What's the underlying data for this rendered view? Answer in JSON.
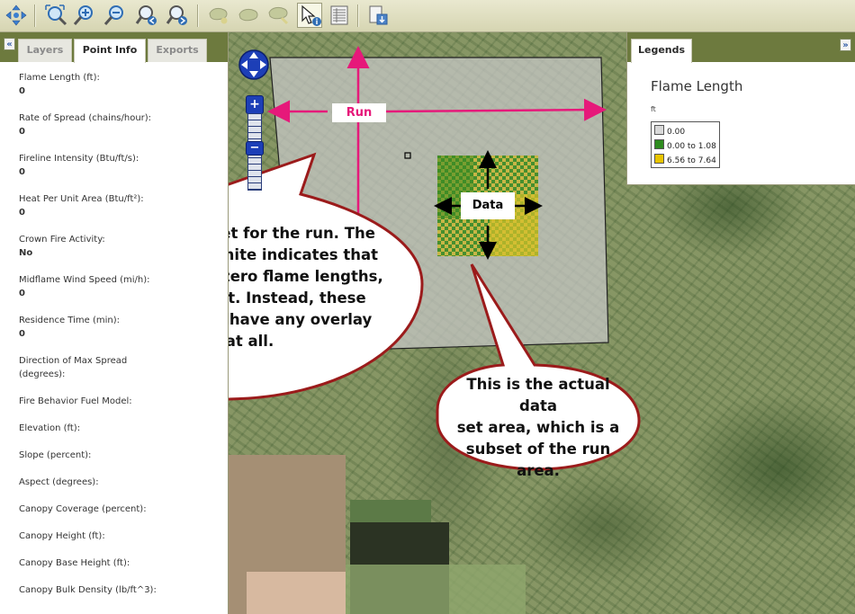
{
  "toolbar": {
    "tools": [
      {
        "name": "pan",
        "tooltip": "Pan"
      },
      {
        "name": "full-extent",
        "tooltip": "Full Extent"
      },
      {
        "name": "zoom-in",
        "tooltip": "Zoom In"
      },
      {
        "name": "zoom-out",
        "tooltip": "Zoom Out"
      },
      {
        "name": "previous-extent",
        "tooltip": "Previous Extent"
      },
      {
        "name": "next-extent",
        "tooltip": "Next Extent"
      },
      {
        "name": "draw-polygon",
        "tooltip": "Draw Area"
      },
      {
        "name": "edit-polygon",
        "tooltip": "Edit Area"
      },
      {
        "name": "clear-polygon",
        "tooltip": "Clear Area"
      },
      {
        "name": "identify",
        "tooltip": "Identify"
      },
      {
        "name": "attribute-table",
        "tooltip": "Table"
      },
      {
        "name": "export",
        "tooltip": "Export"
      }
    ]
  },
  "left_panel": {
    "tabs": [
      {
        "label": "Layers",
        "active": false
      },
      {
        "label": "Point Info",
        "active": true
      },
      {
        "label": "Exports",
        "active": false
      }
    ],
    "collapse_label": "«",
    "fields": [
      {
        "label": "Flame Length (ft):",
        "value": "0"
      },
      {
        "label": "Rate of Spread (chains/hour):",
        "value": "0"
      },
      {
        "label": "Fireline Intensity (Btu/ft/s):",
        "value": "0"
      },
      {
        "label": "Heat Per Unit Area (Btu/ft²):",
        "value": "0"
      },
      {
        "label": "Crown Fire Activity:",
        "value": "No"
      },
      {
        "label": "Midflame Wind Speed (mi/h):",
        "value": "0"
      },
      {
        "label": "Residence Time (min):",
        "value": "0"
      },
      {
        "label": "Direction of Max Spread",
        "value": "(degrees):"
      },
      {
        "label": "Fire Behavior Fuel Model:",
        "value": ""
      },
      {
        "label": "Elevation (ft):",
        "value": ""
      },
      {
        "label": "Slope (percent):",
        "value": ""
      },
      {
        "label": "Aspect (degrees):",
        "value": ""
      },
      {
        "label": "Canopy Coverage (percent):",
        "value": ""
      },
      {
        "label": "Canopy Height (ft):",
        "value": ""
      },
      {
        "label": "Canopy Base Height (ft):",
        "value": ""
      },
      {
        "label": "Canopy Bulk Density (lb/ft^3):",
        "value": ""
      }
    ]
  },
  "legend_panel": {
    "tab_label": "Legends",
    "expand_label": "»",
    "title": "Flame Length",
    "unit": "ft",
    "items": [
      {
        "label": "0.00",
        "color": "#d9d9d9"
      },
      {
        "label": "0.00 to 1.08",
        "color": "#2e8b1e"
      },
      {
        "label": "6.56 to 7.64",
        "color": "#e8c400"
      }
    ]
  },
  "map": {
    "run_label": "Run",
    "data_label": "Data",
    "zoom_plus": "+",
    "zoom_minus": "−",
    "colors": {
      "run_arrow": "#e6197a",
      "callout_border": "#9b1b1b",
      "data_green": "#3c8c1e",
      "data_yellow": "#d9c22a"
    }
  },
  "callouts": {
    "run_area": "This is the area set for the run. The overlay color of white indicates that those pixels have zero flame lengths, which is incorrect. Instead, these pixels should not have any overlay color at all.",
    "run_area_lines": [
      "This is the area set for the run. The",
      "overlay color of white indicates that",
      "those pixels have zero flame lengths,",
      "which is incorrect. Instead, these",
      "pixels should not have any overlay",
      "color at all."
    ],
    "data_area_lines": [
      "This is the actual data",
      "set area, which is a",
      "subset of the run area."
    ]
  }
}
